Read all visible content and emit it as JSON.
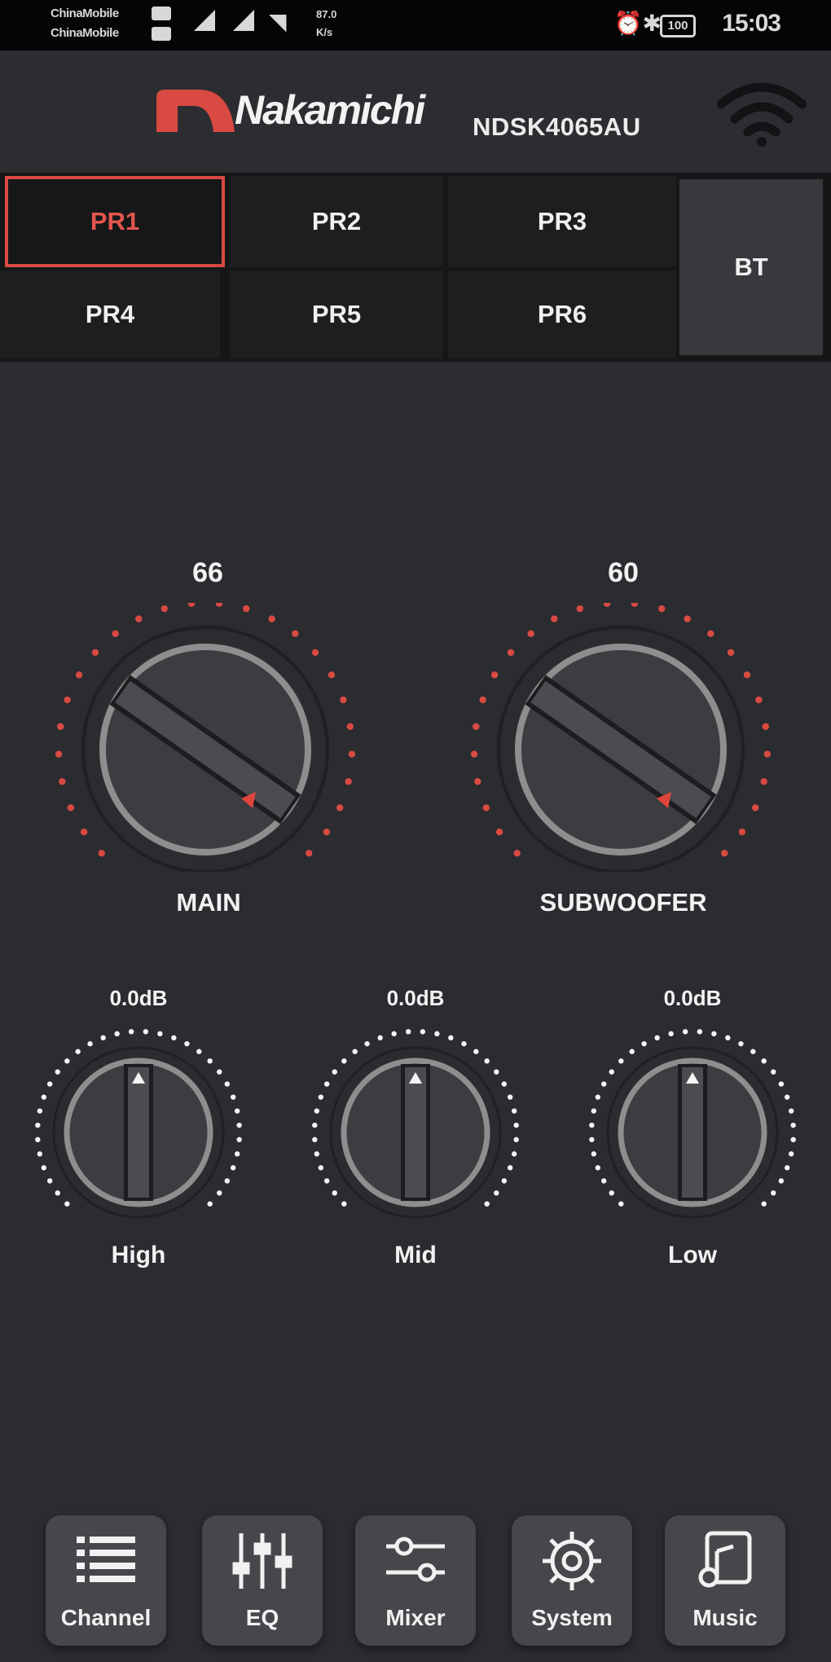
{
  "status_bar": {
    "carrier1": "ChinaMobile",
    "carrier2": "ChinaMobile",
    "speed_value": "87.0",
    "speed_unit": "K/s",
    "battery": "100",
    "time": "15:03"
  },
  "header": {
    "brand": "Nakamichi",
    "model": "NDSK4065AU",
    "brand_color": "#d84a42"
  },
  "presets": {
    "items": [
      "PR1",
      "PR2",
      "PR3",
      "PR4",
      "PR5",
      "PR6"
    ],
    "bt_label": "BT",
    "selected": "PR1"
  },
  "knobs": {
    "main": {
      "value": "66",
      "label": "MAIN"
    },
    "subwoofer": {
      "value": "60",
      "label": "SUBWOOFER"
    },
    "high": {
      "value": "0.0dB",
      "label": "High"
    },
    "mid": {
      "value": "0.0dB",
      "label": "Mid"
    },
    "low": {
      "value": "0.0dB",
      "label": "Low"
    }
  },
  "bottom_nav": {
    "items": [
      {
        "label": "Channel",
        "icon": "channel-list-icon"
      },
      {
        "label": "EQ",
        "icon": "eq-sliders-icon"
      },
      {
        "label": "Mixer",
        "icon": "mixer-icon"
      },
      {
        "label": "System",
        "icon": "gear-icon"
      },
      {
        "label": "Music",
        "icon": "music-note-icon"
      }
    ]
  },
  "colors": {
    "accent": "#d84a42",
    "background": "#2a2c30",
    "dot_white": "#f4f4f4"
  }
}
